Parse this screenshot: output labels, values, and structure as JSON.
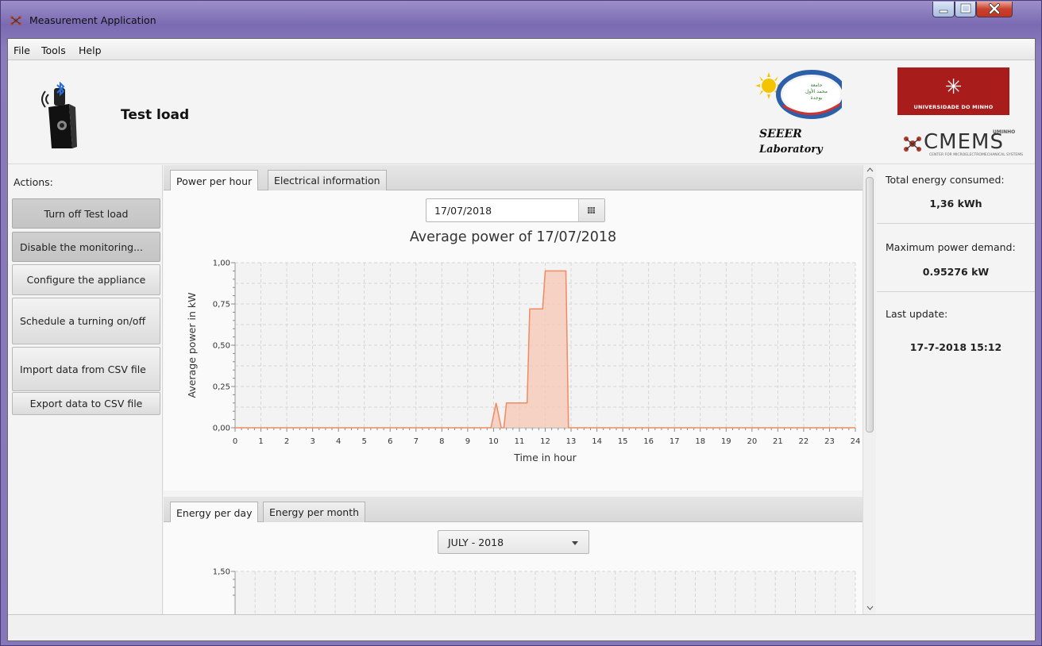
{
  "window": {
    "title": "Measurement Application"
  },
  "menu": {
    "items": [
      "File",
      "Tools",
      "Help"
    ]
  },
  "header": {
    "device_name": "Test load",
    "lab_name_line1": "SEEER",
    "lab_name_line2": "Laboratory",
    "uminho_text": "UNIVERSIDADE DO MINHO",
    "cmems_super": "UMINHO",
    "cmems_text": "CMEMS",
    "cmems_sub": "CENTER FOR MICROELECTROMECHANICAL SYSTEMS"
  },
  "sidebar": {
    "label": "Actions:",
    "buttons": [
      "Turn off Test load",
      "Disable the monitoring...",
      "Configure the appliance",
      "Schedule a turning on/off",
      "Import data from CSV file",
      "Export data to CSV file"
    ]
  },
  "power_panel": {
    "tabs": [
      "Power per hour",
      "Electrical information"
    ],
    "date": "17/07/2018"
  },
  "energy_panel": {
    "tabs": [
      "Energy per day",
      "Energy per month"
    ],
    "month_selected": "JULY - 2018"
  },
  "right_panel": {
    "total_energy_label": "Total energy consumed:",
    "total_energy_value": "1,36 kWh",
    "max_power_label": "Maximum power demand:",
    "max_power_value": "0.95276 kW",
    "last_update_label": "Last update:",
    "last_update_value": "17-7-2018 15:12"
  },
  "colors": {
    "series": "#f08a60",
    "fill": "#f6c7b3",
    "plot_bg": "#f3f3f3",
    "uminho_red": "#a81c1c"
  },
  "chart_data": [
    {
      "type": "area",
      "title": "Average power of 17/07/2018",
      "xlabel": "Time in hour",
      "ylabel": "Average power in kW",
      "xlim": [
        0,
        24
      ],
      "ylim": [
        0,
        1
      ],
      "x_ticks": [
        "0",
        "1",
        "2",
        "3",
        "4",
        "5",
        "6",
        "7",
        "8",
        "9",
        "10",
        "11",
        "12",
        "13",
        "14",
        "15",
        "16",
        "17",
        "18",
        "19",
        "20",
        "21",
        "22",
        "23",
        "24"
      ],
      "y_ticks": [
        "0,00",
        "0,25",
        "0,50",
        "0,75",
        "1,00"
      ],
      "grid": true,
      "series": [
        {
          "x": [
            0,
            9.9,
            10.1,
            10.3,
            10.4,
            10.5,
            11.3,
            11.4,
            11.9,
            12.0,
            12.8,
            12.9,
            24
          ],
          "values": [
            0,
            0,
            0.15,
            0,
            0,
            0.15,
            0.15,
            0.72,
            0.72,
            0.95,
            0.95,
            0,
            0
          ]
        }
      ]
    },
    {
      "type": "bar",
      "y_ticks": [
        "1,50"
      ],
      "ylim": [
        0,
        1.5
      ],
      "grid": true,
      "categories": [],
      "values": []
    }
  ]
}
